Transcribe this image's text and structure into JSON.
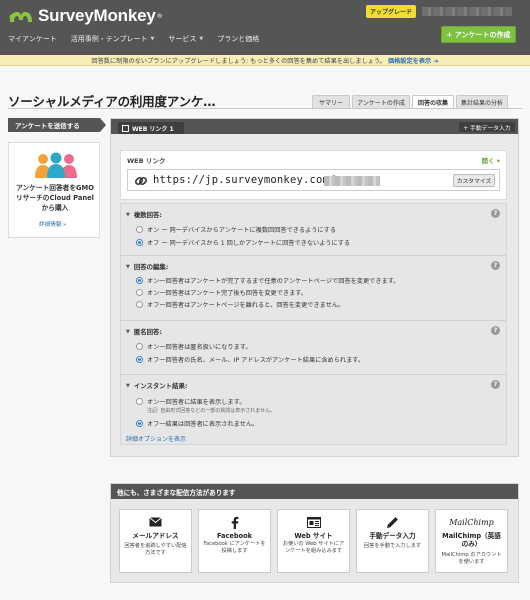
{
  "brand": {
    "name": "SurveyMonkey",
    "tm": "®"
  },
  "header": {
    "upgrade_label": "アップグレード",
    "create_label": "+ アンケートの作成",
    "nav": [
      {
        "label": "マイアンケート"
      },
      {
        "label": "活用事例・テンプレート",
        "caret": "▼"
      },
      {
        "label": "サービス",
        "caret": "▼"
      },
      {
        "label": "プランと価格"
      }
    ]
  },
  "banner": {
    "text": "回答数に制限のないプランにアップグレードしましょう: もっと多くの回答を集めて結果を出しましょう。",
    "link": "価格設定を表示 ➔"
  },
  "page": {
    "title": "ソーシャルメディアの利用度アンケ…",
    "tabs": [
      {
        "label": "サマリー",
        "active": false
      },
      {
        "label": "アンケートの作成",
        "active": false
      },
      {
        "label": "回答の収集",
        "active": true
      },
      {
        "label": "集計結果の分析",
        "active": false
      }
    ]
  },
  "sidebar": {
    "send_label": "アンケートを送信する",
    "gmo_text": "アンケート回答者をGMOリサーチのCloud Panelから購入",
    "gmo_link": "詳細情報 »"
  },
  "collector": {
    "tab_label": "WEB リンク 1",
    "manual_label": "+ 手動データ入力",
    "weblink_label": "WEB リンク",
    "open_label": "開く ▾",
    "url": "https://jp.surveymonkey.com/",
    "customize_label": "カスタマイズ"
  },
  "settings": {
    "sections": [
      {
        "title": "複数回答:",
        "options": [
          {
            "label": "オン ー 同一デバイスからアンケートに複数回回答できるようにする",
            "selected": false
          },
          {
            "label": "オフ ー 同一デバイスから 1 回しかアンケートに回答できないようにする",
            "selected": true
          }
        ]
      },
      {
        "title": "回答の編集:",
        "options": [
          {
            "label": "オン一回答者はアンケートが完了するまで任意のアンケートページで回答を変更できます。",
            "selected": true
          },
          {
            "label": "オン一回答者はアンケート完了後も回答を変更できます。",
            "selected": false
          },
          {
            "label": "オフ一回答者はアンケートページを離れると、回答を変更できません。",
            "selected": false
          }
        ]
      },
      {
        "title": "匿名回答:",
        "options": [
          {
            "label": "オン一回答者は匿名扱いになります。",
            "selected": false
          },
          {
            "label": "オフ一回答者の氏名、メール、IP アドレスがアンケート結果に含められます。",
            "selected": true
          }
        ]
      },
      {
        "title": "インスタント結果:",
        "options": [
          {
            "label": "オン一回答者に結果を表示します。",
            "selected": false,
            "note": "注記: 自由形式回答などの一部の質問は表示されません。"
          },
          {
            "label": "オフ一結果は回答者に表示されません。",
            "selected": true
          }
        ]
      }
    ],
    "advanced_link": "詳細オプションを表示",
    "help": "?"
  },
  "distribution": {
    "title": "他にも、さまざまな配信方法があります",
    "cards": [
      {
        "title": "メールアドレス",
        "desc": "回答者を追跡しやすい配信方法です",
        "icon": "envelope-icon"
      },
      {
        "title": "Facebook",
        "desc": "Facebook にアンケートを投稿します",
        "icon": "facebook-icon"
      },
      {
        "title": "Web サイト",
        "desc": "お使いの Web サイトにアンケートを組み込みます",
        "icon": "website-icon"
      },
      {
        "title": "手動データ入力",
        "desc": "回答を手動で入力します",
        "icon": "pencil-icon"
      },
      {
        "title": "MailChimp（英語のみ）",
        "desc": "MailChimp のアカウントを使います",
        "icon": "mailchimp-logo",
        "logo_text": "MailChimp"
      }
    ]
  },
  "colors": {
    "accent_green": "#7ec141",
    "topbar": "#555555",
    "link_blue": "#2a6fb2",
    "upgrade_yellow": "#f2dd2d"
  }
}
